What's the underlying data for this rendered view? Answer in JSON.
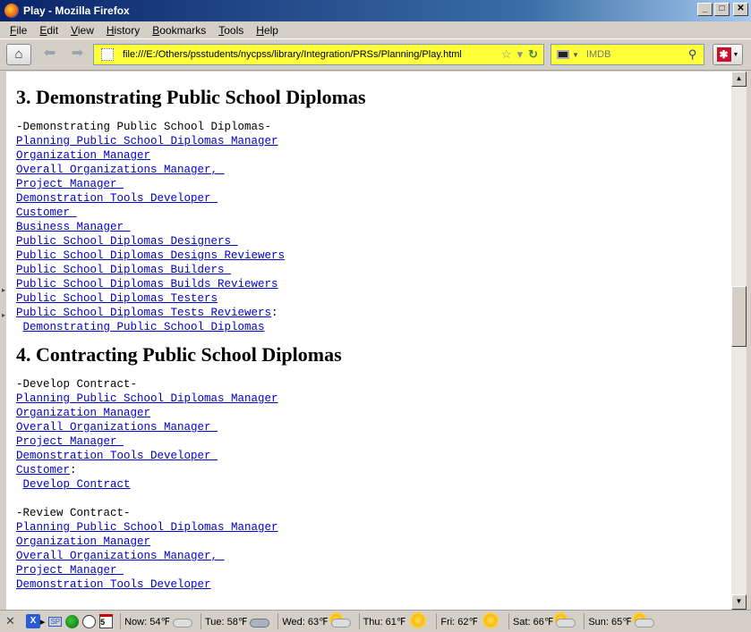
{
  "window": {
    "title": "Play - Mozilla Firefox",
    "buttons": {
      "minimize": "_",
      "maximize": "□",
      "close": "✕"
    }
  },
  "menu": [
    {
      "label": "File",
      "accel": "F",
      "rest": "ile"
    },
    {
      "label": "Edit",
      "accel": "E",
      "rest": "dit"
    },
    {
      "label": "View",
      "accel": "V",
      "rest": "iew"
    },
    {
      "label": "History",
      "accel": "H",
      "rest": "istory"
    },
    {
      "label": "Bookmarks",
      "accel": "B",
      "rest": "ookmarks"
    },
    {
      "label": "Tools",
      "accel": "T",
      "rest": "ools"
    },
    {
      "label": "Help",
      "accel": "H",
      "rest": "elp"
    }
  ],
  "toolbar": {
    "url": "file:///E:/Others/psstudents/nycpss/library/Integration/PRSs/Planning/Play.html",
    "search_placeholder": "IMDB",
    "address_bg": "#ffff3a"
  },
  "icons": {
    "home": "home-icon",
    "back": "back-arrow-icon",
    "forward": "forward-arrow-icon",
    "bookmark_star": "star-icon",
    "reload": "reload-icon",
    "search": "magnifier-icon",
    "addon": "addon-icon"
  },
  "sections": [
    {
      "heading": "3. Demonstrating Public School Diplomas",
      "groups": [
        {
          "label": "-Demonstrating Public School Diplomas-",
          "links": [
            "Planning Public School Diplomas Manager",
            "Organization Manager",
            "Overall Organizations Manager, ",
            "Project Manager ",
            "Demonstration Tools Developer ",
            "Customer ",
            "Business Manager ",
            "Public School Diplomas Designers ",
            "Public School Diplomas Designs Reviewers",
            "Public School Diplomas Builders ",
            "Public School Diplomas Builds Reviewers",
            "Public School Diplomas Testers",
            "Public School Diplomas Tests Reviewers"
          ],
          "suffix": ":",
          "action": "Demonstrating Public School Diplomas"
        }
      ]
    },
    {
      "heading": "4. Contracting Public School Diplomas",
      "groups": [
        {
          "label": "-Develop Contract-",
          "links": [
            "Planning Public School Diplomas Manager",
            "Organization Manager",
            "Overall Organizations Manager ",
            "Project Manager ",
            "Demonstration Tools Developer ",
            "Customer"
          ],
          "suffix": ":",
          "action": "Develop Contract"
        },
        {
          "label": "-Review Contract-",
          "links": [
            "Planning Public School Diplomas Manager",
            "Organization Manager",
            "Overall Organizations Manager, ",
            "Project Manager ",
            "Demonstration Tools Developer"
          ],
          "suffix": "",
          "action": ""
        }
      ]
    }
  ],
  "statusbar": {
    "sp_label": "SP",
    "calendar_day": "5",
    "weather": [
      {
        "label": "Now: 54℉",
        "icon": "cloud"
      },
      {
        "label": "Tue: 58℉",
        "icon": "dark-cloud"
      },
      {
        "label": "Wed: 63℉",
        "icon": "sun-cloud"
      },
      {
        "label": "Thu: 61℉",
        "icon": "sun"
      },
      {
        "label": "Fri: 62℉",
        "icon": "sun"
      },
      {
        "label": "Sat: 66℉",
        "icon": "sun-cloud"
      },
      {
        "label": "Sun: 65℉",
        "icon": "sun-cloud"
      }
    ]
  }
}
